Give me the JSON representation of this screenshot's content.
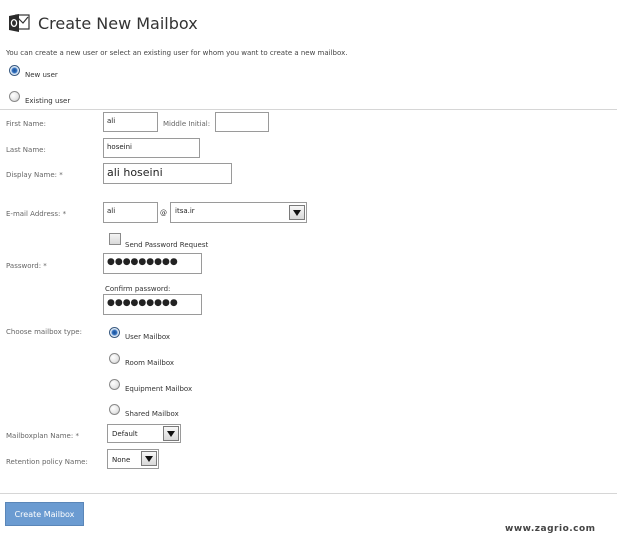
{
  "header": {
    "title": "Create New Mailbox",
    "logo_icon": "outlook-logo-icon"
  },
  "intro": "You can create a new user or select an existing user for whom you want to create a new mailbox.",
  "user_choice": {
    "new_user": "New user",
    "existing_user": "Existing user",
    "selected": "new_user"
  },
  "form": {
    "first_name_label": "First Name:",
    "first_name_value": "ali",
    "middle_initial_label": "Middle Initial:",
    "middle_initial_value": "",
    "last_name_label": "Last Name:",
    "last_name_value": "hoseini",
    "display_name_label": "Display Name: *",
    "display_name_value": "ali hoseini",
    "email_label": "E-mail Address: *",
    "email_user": "ali",
    "email_at": "@",
    "email_domain": "itsa.ir",
    "send_password_label": "Send Password Request",
    "password_label": "Password: *",
    "password_value": "●●●●●●●●●",
    "confirm_password_label": "Confirm password:",
    "confirm_password_value": "●●●●●●●●●",
    "mailbox_type_label": "Choose mailbox type:",
    "mailbox_types": [
      "User Mailbox",
      "Room Mailbox",
      "Equipment Mailbox",
      "Shared Mailbox"
    ],
    "mailbox_type_selected": "User Mailbox",
    "mailboxplan_label": "Mailboxplan Name: *",
    "mailboxplan_value": "Default",
    "retention_label": "Retention policy Name:",
    "retention_value": "None"
  },
  "actions": {
    "create_label": "Create Mailbox"
  },
  "watermark": "www.zagrio.com",
  "colors": {
    "button": "#6b9bd1",
    "radio_selected": "#2f6fbf"
  }
}
